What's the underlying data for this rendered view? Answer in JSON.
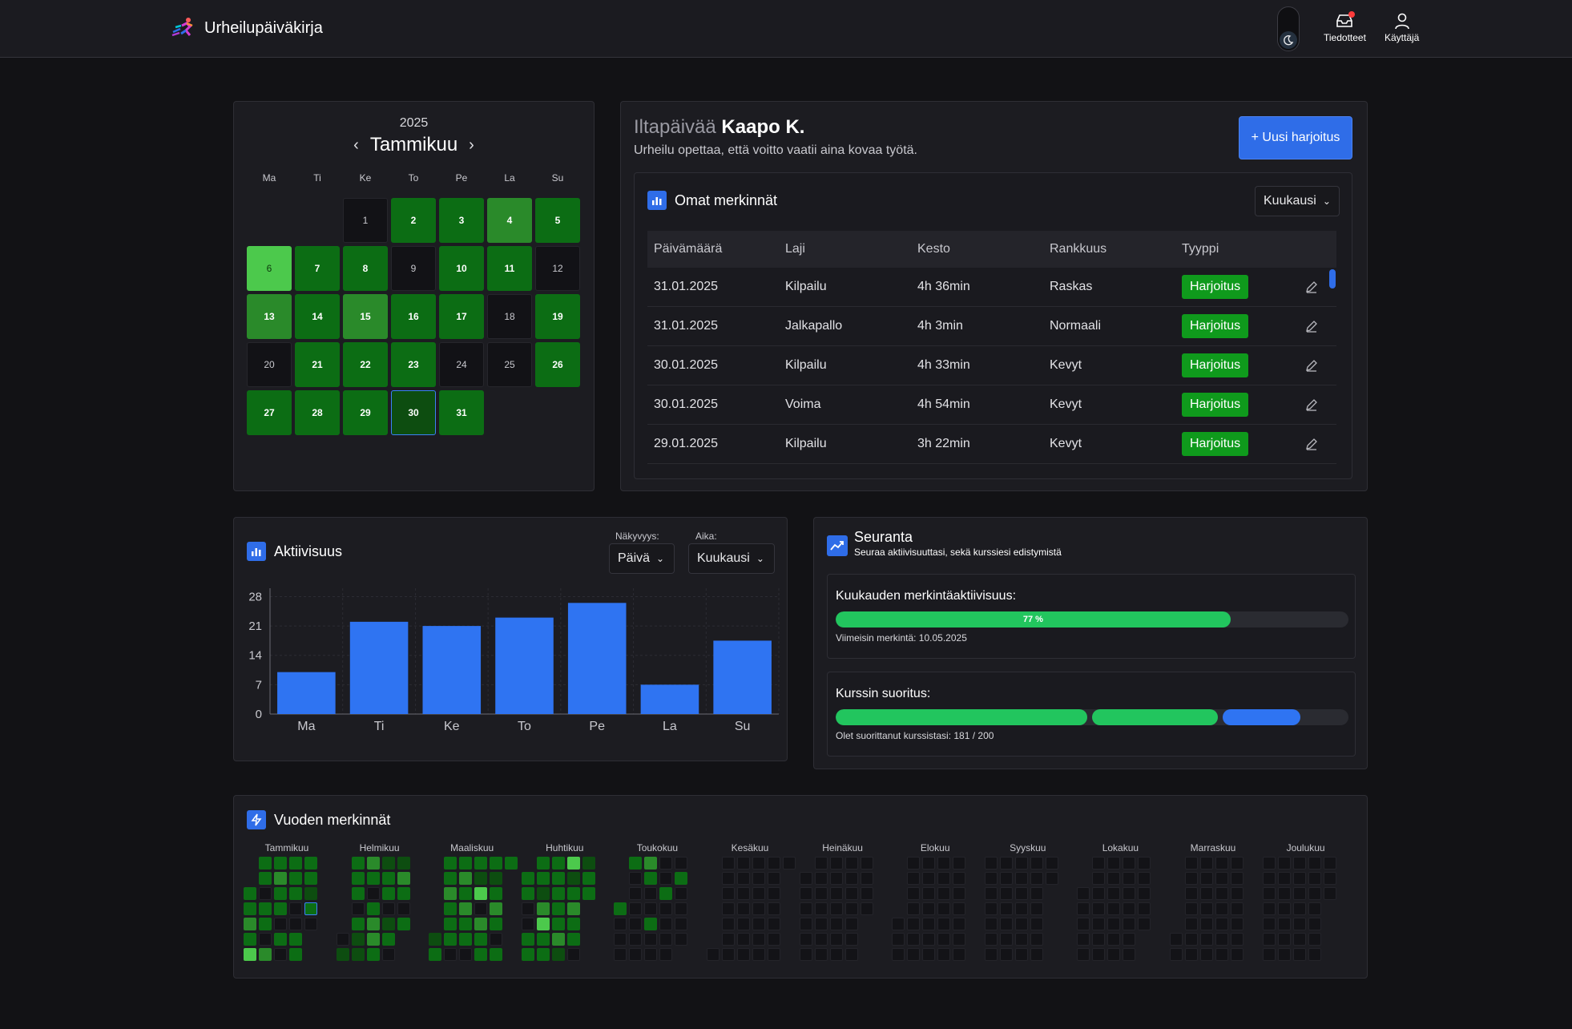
{
  "app": {
    "title": "Urheilupäiväkirja"
  },
  "header": {
    "notifications_label": "Tiedotteet",
    "user_label": "Käyttäjä"
  },
  "calendar": {
    "year": "2025",
    "month": "Tammikuu",
    "weekdays": [
      "Ma",
      "Ti",
      "Ke",
      "To",
      "Pe",
      "La",
      "Su"
    ],
    "leading_blanks": 2,
    "days": [
      {
        "d": "1",
        "level": 0
      },
      {
        "d": "2",
        "level": 2
      },
      {
        "d": "3",
        "level": 2
      },
      {
        "d": "4",
        "level": 3
      },
      {
        "d": "5",
        "level": 2
      },
      {
        "d": "6",
        "level": 4
      },
      {
        "d": "7",
        "level": 2
      },
      {
        "d": "8",
        "level": 2
      },
      {
        "d": "9",
        "level": 0
      },
      {
        "d": "10",
        "level": 2
      },
      {
        "d": "11",
        "level": 2
      },
      {
        "d": "12",
        "level": 0
      },
      {
        "d": "13",
        "level": 3
      },
      {
        "d": "14",
        "level": 2
      },
      {
        "d": "15",
        "level": 3
      },
      {
        "d": "16",
        "level": 2
      },
      {
        "d": "17",
        "level": 2
      },
      {
        "d": "18",
        "level": 0
      },
      {
        "d": "19",
        "level": 2
      },
      {
        "d": "20",
        "level": 0
      },
      {
        "d": "21",
        "level": 2
      },
      {
        "d": "22",
        "level": 2
      },
      {
        "d": "23",
        "level": 2
      },
      {
        "d": "24",
        "level": 0
      },
      {
        "d": "25",
        "level": 0
      },
      {
        "d": "26",
        "level": 2
      },
      {
        "d": "27",
        "level": 2
      },
      {
        "d": "28",
        "level": 2
      },
      {
        "d": "29",
        "level": 2
      },
      {
        "d": "30",
        "level": 1,
        "today": true
      },
      {
        "d": "31",
        "level": 2
      }
    ],
    "colors": [
      "#121216",
      "#0d4d10",
      "#0c6d14",
      "#2a8a2a",
      "#4cc94c"
    ]
  },
  "greeting": {
    "prefix": "Iltapäivää",
    "name": "Kaapo K.",
    "motto": "Urheilu opettaa, että voitto vaatii aina kovaa työtä.",
    "new_button": "+ Uusi harjoitus"
  },
  "entries": {
    "title": "Omat merkinnät",
    "filter": "Kuukausi",
    "columns": [
      "Päivämäärä",
      "Laji",
      "Kesto",
      "Rankkuus",
      "Tyyppi"
    ],
    "rows": [
      {
        "date": "31.01.2025",
        "sport": "Kilpailu",
        "duration": "4h 36min",
        "intensity": "Raskas",
        "type": "Harjoitus"
      },
      {
        "date": "31.01.2025",
        "sport": "Jalkapallo",
        "duration": "4h 3min",
        "intensity": "Normaali",
        "type": "Harjoitus"
      },
      {
        "date": "30.01.2025",
        "sport": "Kilpailu",
        "duration": "4h 33min",
        "intensity": "Kevyt",
        "type": "Harjoitus"
      },
      {
        "date": "30.01.2025",
        "sport": "Voima",
        "duration": "4h 54min",
        "intensity": "Kevyt",
        "type": "Harjoitus"
      },
      {
        "date": "29.01.2025",
        "sport": "Kilpailu",
        "duration": "3h 22min",
        "intensity": "Kevyt",
        "type": "Harjoitus"
      }
    ]
  },
  "activity": {
    "title": "Aktiivisuus",
    "visibility_label": "Näkyvyys:",
    "visibility_value": "Päivä",
    "time_label": "Aika:",
    "time_value": "Kuukausi"
  },
  "chart_data": {
    "type": "bar",
    "categories": [
      "Ma",
      "Ti",
      "Ke",
      "To",
      "Pe",
      "La",
      "Su"
    ],
    "values": [
      10,
      22,
      21,
      23,
      26.5,
      7,
      17.5
    ],
    "yticks": [
      0,
      7,
      14,
      21,
      28
    ],
    "ylim": [
      0,
      30
    ],
    "color": "#2f74f2",
    "grid": true
  },
  "tracking": {
    "title": "Seuranta",
    "subtitle": "Seuraa aktiivisuuttasi, sekä kurssiesi edistymistä",
    "monthly": {
      "heading": "Kuukauden merkintäaktiivisuus:",
      "percent": 77,
      "percent_label": "77 %",
      "note": "Viimeisin merkintä: 10.05.2025"
    },
    "course": {
      "heading": "Kurssin suoritus:",
      "completed": 181,
      "total": 200,
      "note": "Olet suorittanut kurssistasi: 181 / 200"
    }
  },
  "year": {
    "title": "Vuoden merkinnät",
    "months": [
      "Tammikuu",
      "Helmikuu",
      "Maaliskuu",
      "Huhtikuu",
      "Toukokuu",
      "Kesäkuu",
      "Heinäkuu",
      "Elokuu",
      "Syyskuu",
      "Lokakuu",
      "Marraskuu",
      "Joulukuu"
    ]
  }
}
